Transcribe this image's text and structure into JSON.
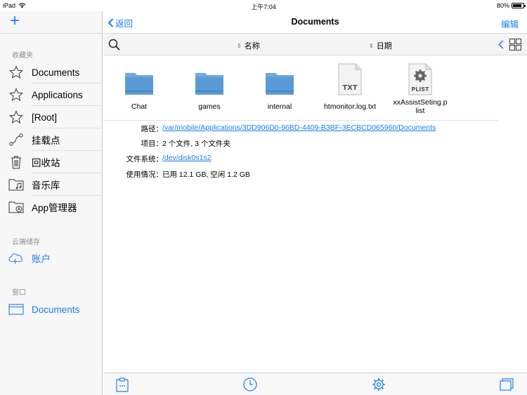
{
  "status_bar": {
    "device": "iPad",
    "time": "上午7:04",
    "battery": "80%"
  },
  "sidebar": {
    "favorites_header": "收藏夹",
    "items": [
      {
        "label": "Documents",
        "icon": "star-outline-icon"
      },
      {
        "label": "Applications",
        "icon": "star-outline-icon"
      },
      {
        "label": "[Root]",
        "icon": "star-outline-icon"
      },
      {
        "label": "挂载点",
        "icon": "mount-point-icon"
      },
      {
        "label": "回收站",
        "icon": "trash-icon"
      },
      {
        "label": "音乐库",
        "icon": "music-folder-icon"
      },
      {
        "label": "App管理器",
        "icon": "app-folder-icon"
      }
    ],
    "cloud_header": "云端储存",
    "cloud_items": [
      {
        "label": "账户",
        "icon": "cloud-add-icon"
      }
    ],
    "window_header": "窗口",
    "window_items": [
      {
        "label": "Documents",
        "icon": "window-icon"
      }
    ]
  },
  "navbar": {
    "back_label": "返回",
    "title": "Documents",
    "edit_label": "编辑"
  },
  "toolbar": {
    "sort_name": "名称",
    "sort_date": "日期"
  },
  "files": [
    {
      "name": "Chat",
      "kind": "folder"
    },
    {
      "name": "games",
      "kind": "folder"
    },
    {
      "name": "internal",
      "kind": "folder"
    },
    {
      "name": "htmonitor.log.txt",
      "kind": "file",
      "badge": "TXT"
    },
    {
      "name_line1": "xxAssistSeting.p",
      "name_line2": "list",
      "kind": "file",
      "badge": "PLIST"
    }
  ],
  "info": {
    "path_label": "路径：",
    "path_value": "/var/mobile/Applications/3DD906D0-96BD-4409-B3BF-3ECBCD065960/Documents",
    "items_label": "项目：",
    "items_value": "2 个文件, 3 个文件夹",
    "fs_label": "文件系统：",
    "fs_value": "/dev/disk0s1s2",
    "usage_label": "使用情况：",
    "usage_value": "已用 12.1 GB, 空闲 1.2 GB"
  },
  "colors": {
    "accent": "#1a7cf4",
    "folder": "#5b9bd5"
  }
}
